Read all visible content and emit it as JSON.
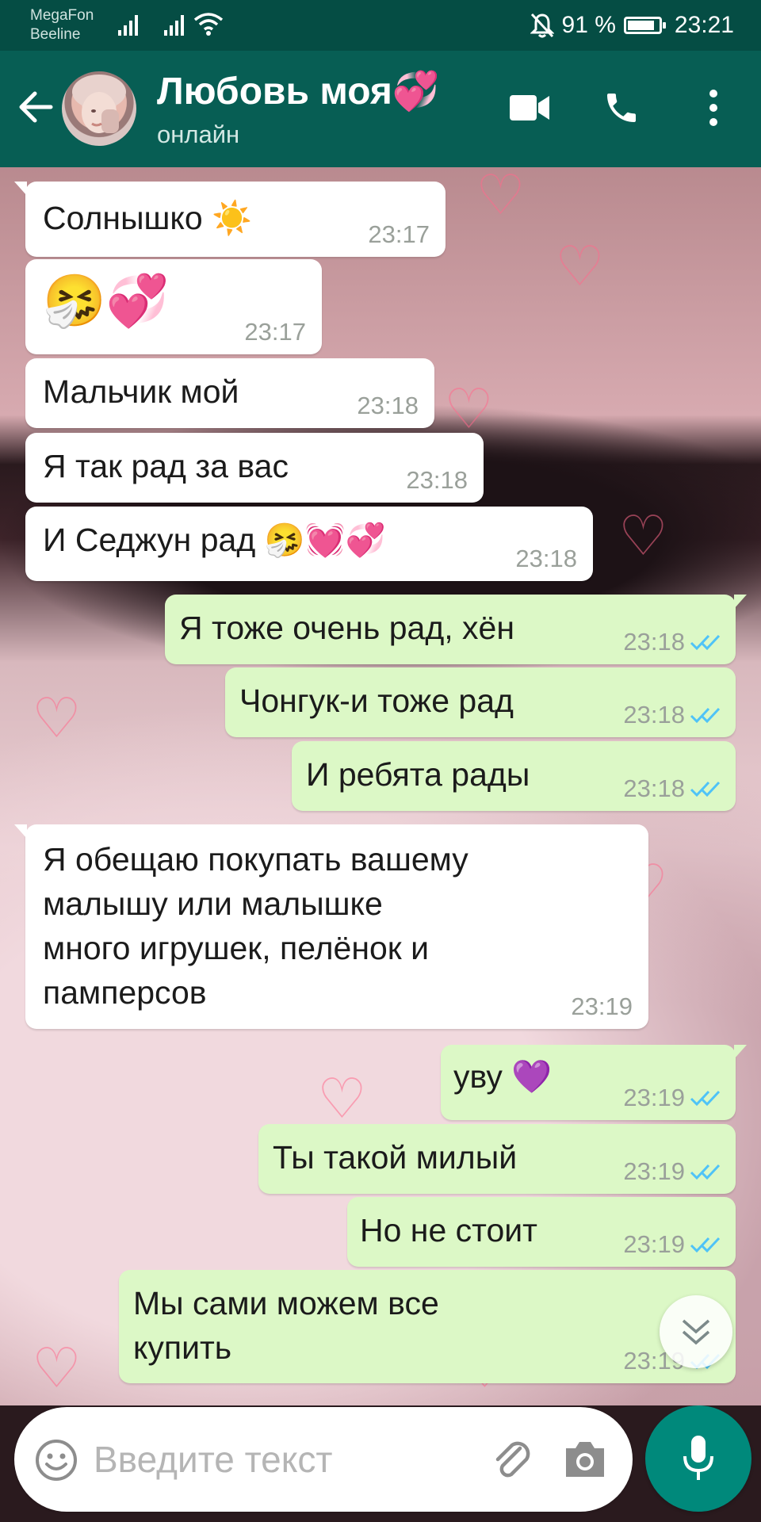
{
  "status_bar": {
    "carrier_1": "MegaFon",
    "carrier_2": "Beeline",
    "battery": "91 %",
    "battery_level": 0.91,
    "time": "23:21"
  },
  "header": {
    "contact_name": "Любовь моя💞",
    "contact_status": "онлайн",
    "icons": [
      "back-arrow-icon",
      "video-call-icon",
      "phone-icon",
      "more-vert-icon"
    ]
  },
  "messages": [
    {
      "dir": "in",
      "text": "Солнышко ☀️",
      "time": "23:17"
    },
    {
      "dir": "in",
      "text": "🤧💞",
      "time": "23:17"
    },
    {
      "dir": "in",
      "text": "Мальчик мой",
      "time": "23:18"
    },
    {
      "dir": "in",
      "text": "Я так рад за вас",
      "time": "23:18"
    },
    {
      "dir": "in",
      "text": "И Седжун рад 🤧💓💞",
      "time": "23:18"
    },
    {
      "dir": "out",
      "text": "Я тоже очень рад, хён",
      "time": "23:18",
      "status": "read"
    },
    {
      "dir": "out",
      "text": "Чонгук-и тоже рад",
      "time": "23:18",
      "status": "read"
    },
    {
      "dir": "out",
      "text": "И ребята рады",
      "time": "23:18",
      "status": "read"
    },
    {
      "dir": "in",
      "text": "Я обещаю покупать вашему\nмалышу или малышке\nмного игрушек, пелёнок и\nпамперсов",
      "time": "23:19"
    },
    {
      "dir": "out",
      "text": "уву 💜",
      "time": "23:19",
      "status": "read"
    },
    {
      "dir": "out",
      "text": "Ты такой милый",
      "time": "23:19",
      "status": "read"
    },
    {
      "dir": "out",
      "text": "Но не стоит",
      "time": "23:19",
      "status": "read"
    },
    {
      "dir": "out",
      "text": "Мы сами можем все\nкупить",
      "time": "23:19",
      "status": "read"
    }
  ],
  "composer": {
    "placeholder": "Введите текст",
    "icons": [
      "emoji-icon",
      "attach-icon",
      "camera-icon",
      "mic-icon"
    ]
  },
  "colors": {
    "header": "#075e54",
    "status_bar": "#054d44",
    "outgoing_bubble": "#dcf8c6",
    "incoming_bubble": "#ffffff",
    "read_ticks": "#4fc3f7",
    "mic_button": "#00897b"
  }
}
